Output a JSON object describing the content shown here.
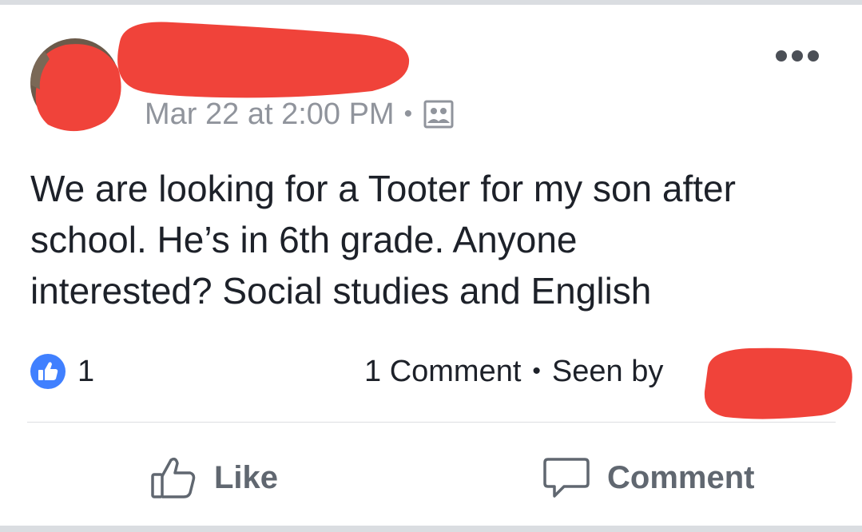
{
  "post": {
    "timestamp": "Mar 22 at 2:00 PM",
    "separator": "•",
    "audience_icon": "friends-audience-icon",
    "text": "We are looking for a Tooter for my son after\nschool.  He’s in 6th grade.  Anyone\ninterested?  Social studies and English",
    "like_count": "1",
    "comment_count": "1 Comment",
    "seen_by": "Seen by"
  },
  "actions": {
    "like_label": "Like",
    "comment_label": "Comment"
  },
  "colors": {
    "redaction": "#f0433a",
    "like_blue": "#4080ff",
    "meta_gray": "#90949c",
    "action_gray": "#606770"
  }
}
